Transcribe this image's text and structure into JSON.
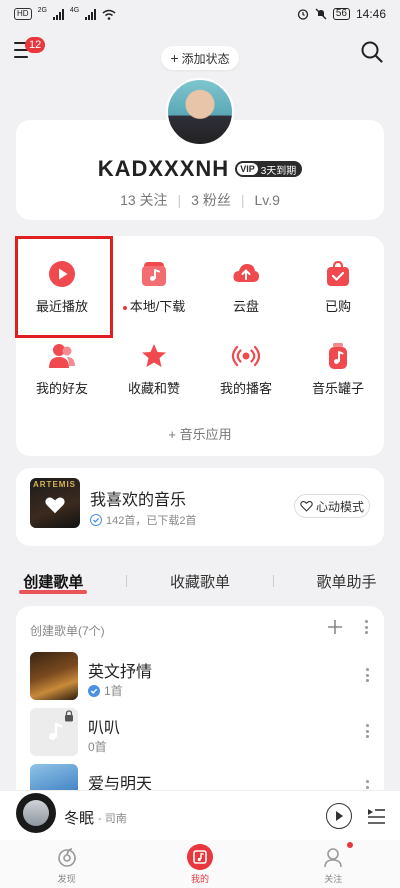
{
  "status_bar": {
    "hd_label": "HD",
    "net1": "2G",
    "net2": "4G",
    "battery": "56",
    "time": "14:46"
  },
  "top_bar": {
    "notification_count": "12",
    "add_status_label": "添加状态"
  },
  "profile": {
    "username": "KADXXXNH",
    "vip_logo": "VIP",
    "vip_text": "3天到期",
    "following": "13 关注",
    "followers": "3 粉丝",
    "level": "Lv.9"
  },
  "apps": {
    "items": [
      {
        "label": "最近播放",
        "icon": "recent-play-icon"
      },
      {
        "label": "本地/下载",
        "icon": "local-download-icon"
      },
      {
        "label": "云盘",
        "icon": "cloud-disk-icon"
      },
      {
        "label": "已购",
        "icon": "purchased-icon"
      },
      {
        "label": "我的好友",
        "icon": "friends-icon"
      },
      {
        "label": "收藏和赞",
        "icon": "favorites-icon"
      },
      {
        "label": "我的播客",
        "icon": "podcast-icon"
      },
      {
        "label": "音乐罐子",
        "icon": "music-jar-icon"
      }
    ],
    "music_apps_label": "音乐应用"
  },
  "favorite": {
    "cover_text": "ARTEMIS",
    "title": "我喜欢的音乐",
    "subtitle": "142首，已下载2首",
    "heart_mode": "心动模式"
  },
  "tabs": [
    "创建歌单",
    "收藏歌单",
    "歌单助手"
  ],
  "playlists": {
    "header": "创建歌单(7个)",
    "items": [
      {
        "name": "英文抒情",
        "count": "1首"
      },
      {
        "name": "叭叭",
        "count": "0首"
      },
      {
        "name": "爱与明天",
        "count": ""
      }
    ]
  },
  "player": {
    "title": "冬眠",
    "artist": "- 司南"
  },
  "bottom_nav": [
    {
      "label": "发现"
    },
    {
      "label": "我的"
    },
    {
      "label": "关注"
    }
  ],
  "colors": {
    "accent": "#e8383d",
    "highlight_box": "#e02020",
    "background": "#f1f1f3"
  }
}
